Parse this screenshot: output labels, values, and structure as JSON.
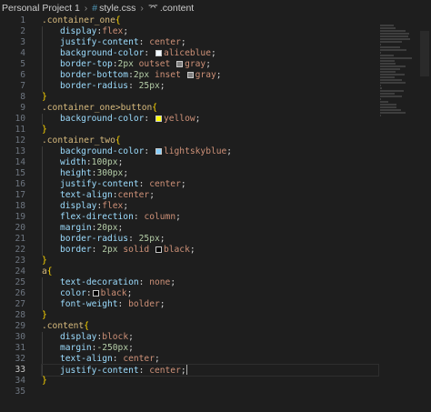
{
  "breadcrumb": {
    "project": "Personal Project 1",
    "file": "style.css",
    "symbol": ".content"
  },
  "colors": {
    "background": "#1e1e1e",
    "selector": "#d7ba7d",
    "property": "#9cdcfe",
    "value": "#ce9178",
    "number": "#b5cea8",
    "bracket": "#ffd700"
  },
  "editor": {
    "active_line": 33,
    "lines": [
      {
        "n": "1",
        "tokens": [
          [
            "sel",
            ".container_one"
          ],
          [
            "brace",
            "{"
          ]
        ]
      },
      {
        "n": "2",
        "indent": 1,
        "tokens": [
          [
            "prop",
            "display"
          ],
          [
            "punct",
            ":"
          ],
          [
            "val",
            "flex"
          ],
          [
            "punct",
            ";"
          ]
        ]
      },
      {
        "n": "3",
        "indent": 1,
        "tokens": [
          [
            "prop",
            "justify-content"
          ],
          [
            "punct",
            ": "
          ],
          [
            "val",
            "center"
          ],
          [
            "punct",
            ";"
          ]
        ]
      },
      {
        "n": "4",
        "indent": 1,
        "tokens": [
          [
            "prop",
            "background-color"
          ],
          [
            "punct",
            ": "
          ],
          [
            "swatch",
            "#f0f8ff"
          ],
          [
            "val",
            "aliceblue"
          ],
          [
            "punct",
            ";"
          ]
        ]
      },
      {
        "n": "5",
        "indent": 1,
        "tokens": [
          [
            "prop",
            "border-top"
          ],
          [
            "punct",
            ":"
          ],
          [
            "num",
            "2px"
          ],
          [
            "val",
            " outset "
          ],
          [
            "swatch",
            "#808080"
          ],
          [
            "val",
            "gray"
          ],
          [
            "punct",
            ";"
          ]
        ]
      },
      {
        "n": "6",
        "indent": 1,
        "tokens": [
          [
            "prop",
            "border-bottom"
          ],
          [
            "punct",
            ":"
          ],
          [
            "num",
            "2px"
          ],
          [
            "val",
            " inset "
          ],
          [
            "swatch",
            "#808080"
          ],
          [
            "val",
            "gray"
          ],
          [
            "punct",
            ";"
          ]
        ]
      },
      {
        "n": "7",
        "indent": 1,
        "tokens": [
          [
            "prop",
            "border-radius"
          ],
          [
            "punct",
            ": "
          ],
          [
            "num",
            "25px"
          ],
          [
            "punct",
            ";"
          ]
        ]
      },
      {
        "n": "8",
        "tokens": [
          [
            "brace",
            "}"
          ]
        ]
      },
      {
        "n": "9",
        "tokens": [
          [
            "sel",
            ".container_one>button"
          ],
          [
            "brace",
            "{"
          ]
        ]
      },
      {
        "n": "10",
        "indent": 1,
        "tokens": [
          [
            "prop",
            "background-color"
          ],
          [
            "punct",
            ": "
          ],
          [
            "swatch",
            "#ffff00"
          ],
          [
            "val",
            "yellow"
          ],
          [
            "punct",
            ";"
          ]
        ]
      },
      {
        "n": "11",
        "tokens": [
          [
            "brace",
            "}"
          ]
        ]
      },
      {
        "n": "12",
        "tokens": [
          [
            "sel",
            ".container_two"
          ],
          [
            "brace",
            "{"
          ]
        ]
      },
      {
        "n": "13",
        "indent": 1,
        "tokens": [
          [
            "prop",
            "background-color"
          ],
          [
            "punct",
            ": "
          ],
          [
            "swatch",
            "#87cefa"
          ],
          [
            "val",
            "lightskyblue"
          ],
          [
            "punct",
            ";"
          ]
        ]
      },
      {
        "n": "14",
        "indent": 1,
        "tokens": [
          [
            "prop",
            "width"
          ],
          [
            "punct",
            ":"
          ],
          [
            "num",
            "100px"
          ],
          [
            "punct",
            ";"
          ]
        ]
      },
      {
        "n": "15",
        "indent": 1,
        "tokens": [
          [
            "prop",
            "height"
          ],
          [
            "punct",
            ":"
          ],
          [
            "num",
            "300px"
          ],
          [
            "punct",
            ";"
          ]
        ]
      },
      {
        "n": "16",
        "indent": 1,
        "tokens": [
          [
            "prop",
            "justify-content"
          ],
          [
            "punct",
            ": "
          ],
          [
            "val",
            "center"
          ],
          [
            "punct",
            ";"
          ]
        ]
      },
      {
        "n": "17",
        "indent": 1,
        "tokens": [
          [
            "prop",
            "text-align"
          ],
          [
            "punct",
            ":"
          ],
          [
            "val",
            "center"
          ],
          [
            "punct",
            ";"
          ]
        ]
      },
      {
        "n": "18",
        "indent": 1,
        "tokens": [
          [
            "prop",
            "display"
          ],
          [
            "punct",
            ":"
          ],
          [
            "val",
            "flex"
          ],
          [
            "punct",
            ";"
          ]
        ]
      },
      {
        "n": "19",
        "indent": 1,
        "tokens": [
          [
            "prop",
            "flex-direction"
          ],
          [
            "punct",
            ": "
          ],
          [
            "val",
            "column"
          ],
          [
            "punct",
            ";"
          ]
        ]
      },
      {
        "n": "20",
        "indent": 1,
        "tokens": [
          [
            "prop",
            "margin"
          ],
          [
            "punct",
            ":"
          ],
          [
            "num",
            "20px"
          ],
          [
            "punct",
            ";"
          ]
        ]
      },
      {
        "n": "21",
        "indent": 1,
        "tokens": [
          [
            "prop",
            "border-radius"
          ],
          [
            "punct",
            ": "
          ],
          [
            "num",
            "25px"
          ],
          [
            "punct",
            ";"
          ]
        ]
      },
      {
        "n": "22",
        "indent": 1,
        "tokens": [
          [
            "prop",
            "border"
          ],
          [
            "punct",
            ": "
          ],
          [
            "num",
            "2px"
          ],
          [
            "val",
            " solid "
          ],
          [
            "swatch",
            "#000000"
          ],
          [
            "val",
            "black"
          ],
          [
            "punct",
            ";"
          ]
        ]
      },
      {
        "n": "23",
        "tokens": [
          [
            "brace",
            "}"
          ]
        ]
      },
      {
        "n": "24",
        "tokens": [
          [
            "sel",
            "a"
          ],
          [
            "brace",
            "{"
          ]
        ]
      },
      {
        "n": "25",
        "indent": 1,
        "tokens": [
          [
            "prop",
            "text-decoration"
          ],
          [
            "punct",
            ": "
          ],
          [
            "val",
            "none"
          ],
          [
            "punct",
            ";"
          ]
        ]
      },
      {
        "n": "26",
        "indent": 1,
        "tokens": [
          [
            "prop",
            "color"
          ],
          [
            "punct",
            ":"
          ],
          [
            "swatch",
            "#000000"
          ],
          [
            "val",
            "black"
          ],
          [
            "punct",
            ";"
          ]
        ]
      },
      {
        "n": "27",
        "indent": 1,
        "tokens": [
          [
            "prop",
            "font-weight"
          ],
          [
            "punct",
            ": "
          ],
          [
            "val",
            "bolder"
          ],
          [
            "punct",
            ";"
          ]
        ]
      },
      {
        "n": "28",
        "tokens": [
          [
            "brace",
            "}"
          ]
        ]
      },
      {
        "n": "29",
        "tokens": [
          [
            "sel",
            ".content"
          ],
          [
            "brace",
            "{"
          ]
        ]
      },
      {
        "n": "30",
        "indent": 1,
        "tokens": [
          [
            "prop",
            "display"
          ],
          [
            "punct",
            ":"
          ],
          [
            "val",
            "block"
          ],
          [
            "punct",
            ";"
          ]
        ]
      },
      {
        "n": "31",
        "indent": 1,
        "tokens": [
          [
            "prop",
            "margin"
          ],
          [
            "punct",
            ":"
          ],
          [
            "num",
            "-250px"
          ],
          [
            "punct",
            ";"
          ]
        ]
      },
      {
        "n": "32",
        "indent": 1,
        "tokens": [
          [
            "prop",
            "text-align"
          ],
          [
            "punct",
            ": "
          ],
          [
            "val",
            "center"
          ],
          [
            "punct",
            ";"
          ]
        ]
      },
      {
        "n": "33",
        "indent": 1,
        "tokens": [
          [
            "prop",
            "justify-content"
          ],
          [
            "punct",
            ": "
          ],
          [
            "val",
            "center"
          ],
          [
            "punct",
            ";"
          ],
          [
            "cursor",
            ""
          ]
        ]
      },
      {
        "n": "34",
        "tokens": [
          [
            "brace",
            "}"
          ]
        ]
      },
      {
        "n": "35",
        "tokens": []
      }
    ]
  }
}
